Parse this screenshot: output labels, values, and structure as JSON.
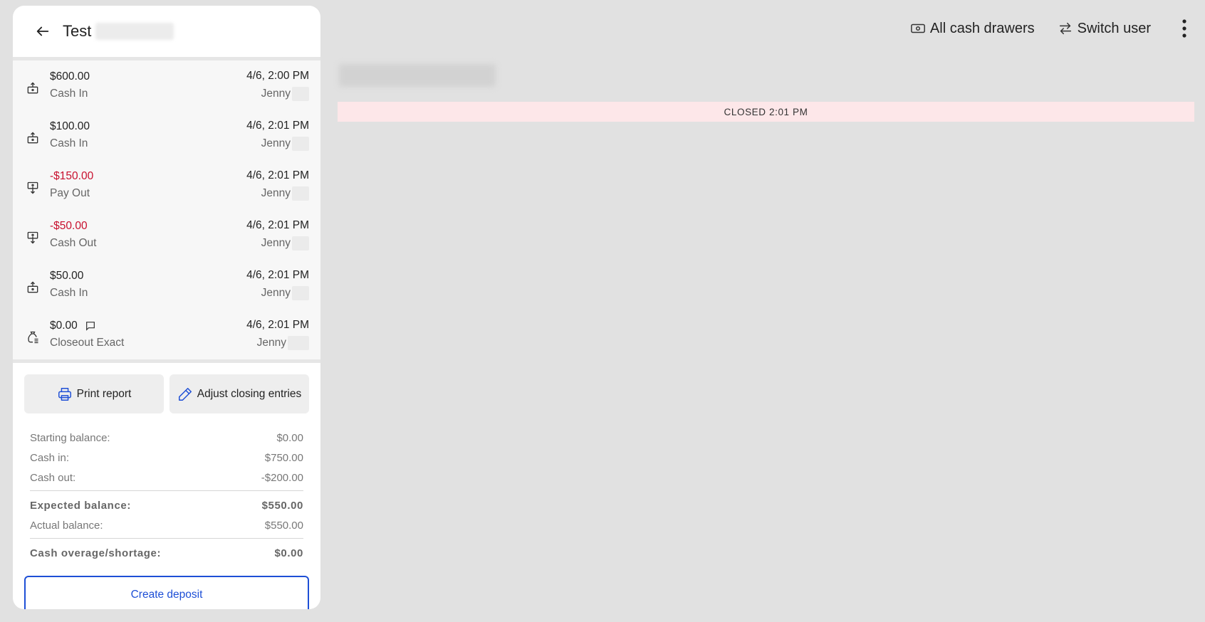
{
  "panel": {
    "title": "Test",
    "entries": [
      {
        "icon": "cash-in-icon",
        "amount": "$600.00",
        "negative": false,
        "type": "Cash In",
        "time": "4/6, 2:00 PM",
        "user": "Jenny",
        "comment": false
      },
      {
        "icon": "cash-in-icon",
        "amount": "$100.00",
        "negative": false,
        "type": "Cash In",
        "time": "4/6, 2:01 PM",
        "user": "Jenny",
        "comment": false
      },
      {
        "icon": "pay-out-icon",
        "amount": "-$150.00",
        "negative": true,
        "type": "Pay Out",
        "time": "4/6, 2:01 PM",
        "user": "Jenny",
        "comment": false
      },
      {
        "icon": "pay-out-icon",
        "amount": "-$50.00",
        "negative": true,
        "type": "Cash Out",
        "time": "4/6, 2:01 PM",
        "user": "Jenny",
        "comment": false
      },
      {
        "icon": "cash-in-icon",
        "amount": "$50.00",
        "negative": false,
        "type": "Cash In",
        "time": "4/6, 2:01 PM",
        "user": "Jenny",
        "comment": false
      },
      {
        "icon": "money-bag-icon",
        "amount": "$0.00",
        "negative": false,
        "type": "Closeout Exact",
        "time": "4/6, 2:01 PM",
        "user": "Jenny",
        "comment": true
      }
    ],
    "actions": {
      "print_label": "Print report",
      "adjust_label": "Adjust closing entries"
    },
    "summary": {
      "starting_label": "Starting balance:",
      "starting_value": "$0.00",
      "cash_in_label": "Cash in:",
      "cash_in_value": "$750.00",
      "cash_out_label": "Cash out:",
      "cash_out_value": "-$200.00",
      "expected_label": "Expected balance:",
      "expected_value": "$550.00",
      "actual_label": "Actual balance:",
      "actual_value": "$550.00",
      "overage_label": "Cash overage/shortage:",
      "overage_value": "$0.00"
    },
    "deposit_label": "Create deposit"
  },
  "topbar": {
    "all_drawers_label": "All cash drawers",
    "switch_user_label": "Switch user"
  },
  "status": {
    "closed_text": "CLOSED 2:01 PM"
  },
  "colors": {
    "accent": "#1e4fd6",
    "negative": "#c8102e",
    "closed_bg": "#fde7e9"
  }
}
